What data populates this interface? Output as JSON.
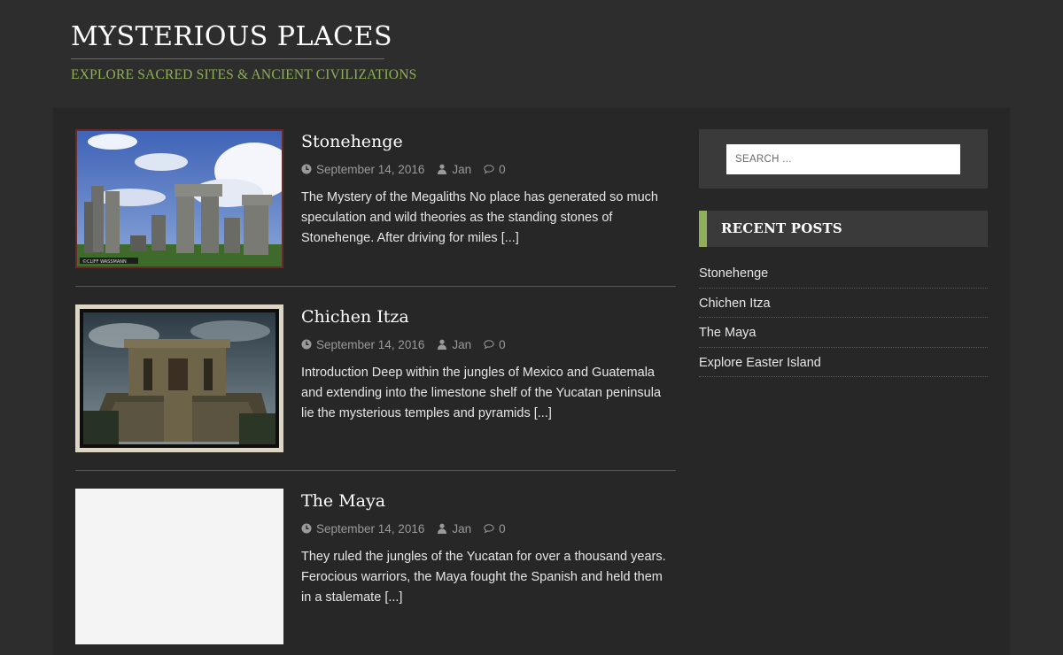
{
  "site": {
    "title": "MYSTERIOUS PLACES",
    "description": "EXPLORE SACRED SITES & ANCIENT CIVILIZATIONS"
  },
  "colors": {
    "accent": "#8faf58",
    "background": "#2d2d2d",
    "panel": "#272727",
    "widget": "#3a3a3a"
  },
  "posts": [
    {
      "title": "Stonehenge",
      "date": "September 14, 2016",
      "author": "Jan",
      "comments": "0",
      "excerpt": "The Mystery of the Megaliths No place has generated so much speculation and wild theories as the standing stones of Stonehenge. After driving for miles",
      "read_more": "[...]",
      "thumbnail_credit": "©CLIFF WASSMANN"
    },
    {
      "title": "Chichen Itza",
      "date": "September 14, 2016",
      "author": "Jan",
      "comments": "0",
      "excerpt": "Introduction Deep within the jungles of Mexico and Guatemala and extending into the limestone shelf of the Yucatan peninsula lie the mysterious temples and pyramids",
      "read_more": "[...]"
    },
    {
      "title": "The Maya",
      "date": "September 14, 2016",
      "author": "Jan",
      "comments": "0",
      "excerpt": "They ruled the jungles of the Yucatan for over a thousand years. Ferocious warriors, the Maya fought the Spanish and held them in a stalemate",
      "read_more": "[...]"
    }
  ],
  "sidebar": {
    "search_placeholder": "SEARCH ...",
    "recent_posts_title": "RECENT POSTS",
    "recent_posts": [
      "Stonehenge",
      "Chichen Itza",
      "The Maya",
      "Explore Easter Island"
    ]
  },
  "icons": {
    "date": "clock-icon",
    "author": "user-icon",
    "comments": "comment-icon"
  }
}
